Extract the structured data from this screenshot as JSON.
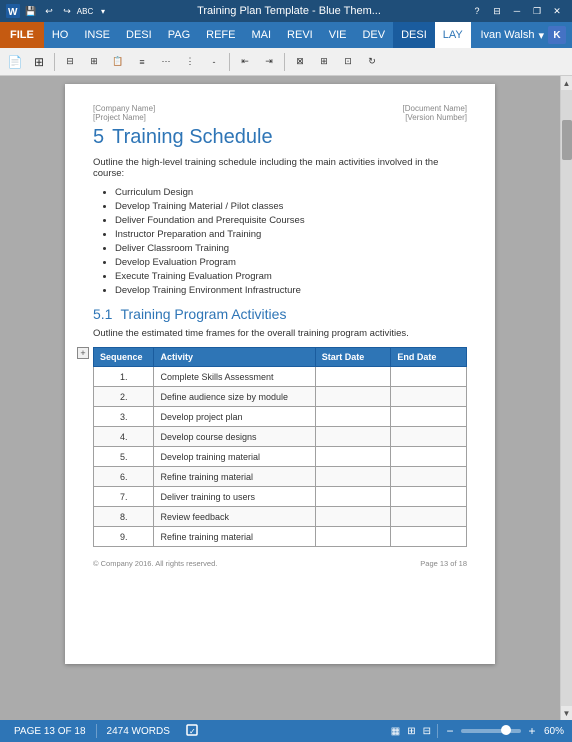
{
  "titlebar": {
    "title": "Training Plan Template - Blue Them...",
    "help_icon": "?",
    "minimize": "─",
    "restore": "❐",
    "close": "✕"
  },
  "ribbon": {
    "tabs": [
      "FILE",
      "HO",
      "INSE",
      "DESI",
      "PAG",
      "REFE",
      "MAI",
      "REVI",
      "VIE",
      "DEV",
      "DESI",
      "LAY"
    ],
    "active_tab": "LAY",
    "highlight_tab": "DESI",
    "user": "Ivan Walsh",
    "user_initial": "K"
  },
  "toolbar": {
    "title": "Training Plan Template"
  },
  "page": {
    "meta_left": {
      "company": "[Company Name]",
      "project": "[Project Name]"
    },
    "meta_right": {
      "doc": "[Document Name]",
      "version": "[Version Number]"
    },
    "section": {
      "number": "5",
      "title": "Training Schedule",
      "intro": "Outline the high-level training schedule including the main activities involved in the course:",
      "bullets": [
        "Curriculum Design",
        "Develop Training Material / Pilot classes",
        "Deliver Foundation and Prerequisite Courses",
        "Instructor Preparation and Training",
        "Deliver Classroom Training",
        "Develop Evaluation Program",
        "Execute Training Evaluation Program",
        "Develop Training Environment Infrastructure"
      ]
    },
    "subsection": {
      "number": "5.1",
      "title": "Training Program Activities",
      "intro": "Outline the estimated time frames for the overall training program activities.",
      "table": {
        "headers": [
          "Sequence",
          "Activity",
          "Start Date",
          "End Date"
        ],
        "rows": [
          {
            "seq": "1.",
            "activity": "Complete Skills Assessment",
            "start": "",
            "end": ""
          },
          {
            "seq": "2.",
            "activity": "Define audience size by module",
            "start": "",
            "end": ""
          },
          {
            "seq": "3.",
            "activity": "Develop project plan",
            "start": "",
            "end": ""
          },
          {
            "seq": "4.",
            "activity": "Develop course designs",
            "start": "",
            "end": ""
          },
          {
            "seq": "5.",
            "activity": "Develop training material",
            "start": "",
            "end": ""
          },
          {
            "seq": "6.",
            "activity": "Refine training material",
            "start": "",
            "end": ""
          },
          {
            "seq": "7.",
            "activity": "Deliver training to users",
            "start": "",
            "end": ""
          },
          {
            "seq": "8.",
            "activity": "Review feedback",
            "start": "",
            "end": ""
          },
          {
            "seq": "9.",
            "activity": "Refine training material",
            "start": "",
            "end": ""
          }
        ]
      }
    },
    "footer": {
      "left": "© Company 2016. All rights reserved.",
      "right": "Page 13 of 18"
    }
  },
  "statusbar": {
    "page": "PAGE 13 OF 18",
    "words": "2474 WORDS",
    "zoom": "60%"
  }
}
